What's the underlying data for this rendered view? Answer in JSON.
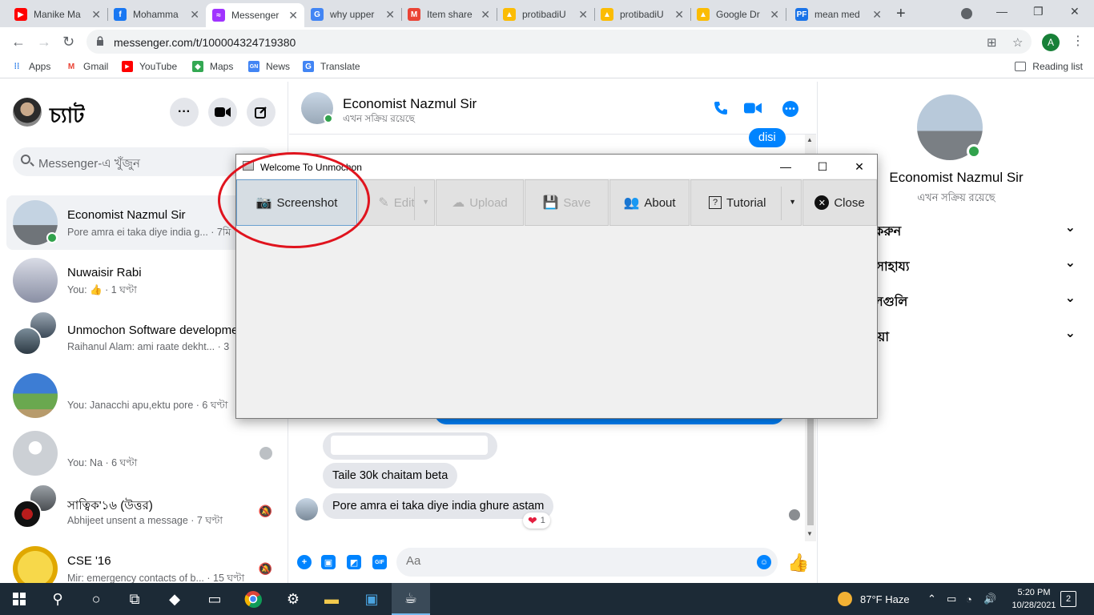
{
  "browser": {
    "tabs": [
      {
        "title": "Manike Ma",
        "fav_color": "#ff0000",
        "fav_glyph": "▶"
      },
      {
        "title": "Mohamma",
        "fav_color": "#1877f2",
        "fav_glyph": "f"
      },
      {
        "title": "Messenger",
        "fav_color": "#a033ff",
        "fav_glyph": "≈"
      },
      {
        "title": "why upper",
        "fav_color": "#4285f4",
        "fav_glyph": "G"
      },
      {
        "title": "Item share",
        "fav_color": "#ea4335",
        "fav_glyph": "M"
      },
      {
        "title": "protibadiU",
        "fav_color": "#fbbc04",
        "fav_glyph": "▲"
      },
      {
        "title": "protibadiU",
        "fav_color": "#fbbc04",
        "fav_glyph": "▲"
      },
      {
        "title": "Google Dr",
        "fav_color": "#fbbc04",
        "fav_glyph": "▲"
      },
      {
        "title": "mean med",
        "fav_color": "#1a73e8",
        "fav_glyph": "PF"
      }
    ],
    "url": "messenger.com/t/100004324719380",
    "profile_initial": "A",
    "bookmarks": [
      {
        "label": "Apps",
        "icon": "apps-grid-icon"
      },
      {
        "label": "Gmail",
        "icon": "gmail-icon"
      },
      {
        "label": "YouTube",
        "icon": "youtube-icon"
      },
      {
        "label": "Maps",
        "icon": "maps-icon"
      },
      {
        "label": "News",
        "icon": "news-icon"
      },
      {
        "label": "Translate",
        "icon": "translate-icon"
      }
    ],
    "reading_list": "Reading list"
  },
  "messenger": {
    "left": {
      "title": "চ্যাট",
      "search_placeholder": "Messenger-এ খুঁজুন",
      "chats": [
        {
          "name": "Economist Nazmul Sir",
          "snippet": "Pore amra ei taka diye india g... · 7মি",
          "active": true
        },
        {
          "name": "Nuwaisir Rabi",
          "snippet": "You: 👍 · 1 ঘণ্টা"
        },
        {
          "name": "Unmochon Software developme",
          "snippet": "Raihanul Alam: ami raate dekht... · 3"
        },
        {
          "name": "",
          "snippet": "You: Janacchi apu,ektu pore · 6 ঘণ্টা"
        },
        {
          "name": "",
          "snippet": "You: Na · 6 ঘণ্টা"
        },
        {
          "name": "সাত্বিক'১৬ (উত্তর)",
          "snippet": "Abhijeet unsent a message · 7 ঘণ্টা"
        },
        {
          "name": "CSE '16",
          "snippet": "Mir: emergency contacts of b... · 15 ঘণ্টা"
        }
      ]
    },
    "conversation": {
      "name": "Economist Nazmul Sir",
      "status": "এখন সক্রিয় রয়েছে",
      "messages": [
        {
          "text": "disi",
          "dir": "out"
        },
        {
          "text": "Taile 30k chaitam beta",
          "dir": "in"
        },
        {
          "text": "Pore amra ei taka diye india ghure astam",
          "dir": "in"
        }
      ],
      "reaction_count": "1",
      "composer_placeholder": "Aa"
    },
    "right": {
      "name": "Economist Nazmul Sir",
      "status": "এখন সক্রিয় রয়েছে",
      "sections": [
        "স্টমাইজ করুন",
        "ি এবং সাহায্য",
        "করা ফাইলগুলি",
        "করা মিডিয়া"
      ]
    }
  },
  "dialog": {
    "title": "Welcome To Unmochon",
    "buttons": {
      "screenshot": "Screenshot",
      "edit": "Edit",
      "upload": "Upload",
      "save": "Save",
      "about": "About",
      "tutorial": "Tutorial",
      "close": "Close"
    }
  },
  "taskbar": {
    "weather": "87°F  Haze",
    "time": "5:20 PM",
    "date": "10/28/2021",
    "notifications": "2"
  }
}
